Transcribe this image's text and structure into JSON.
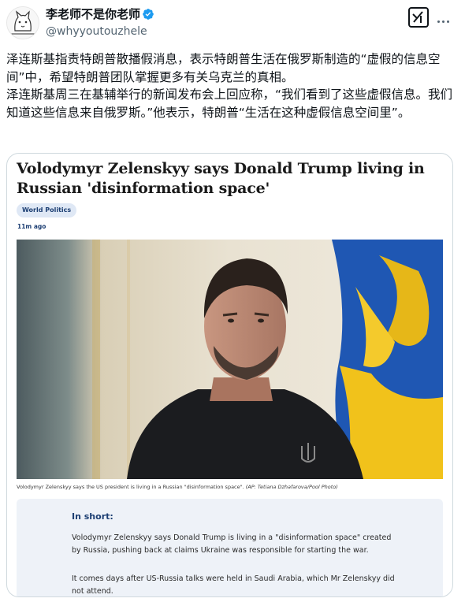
{
  "author": {
    "display_name": "李老师不是你老师",
    "handle": "@whyyoutouzhele"
  },
  "icons": {
    "verified": "verified-badge-icon",
    "grok": "grok-icon",
    "more": "more-icon"
  },
  "colors": {
    "verified": "#1d9bf0",
    "tag_bg": "#dfe8f5",
    "accent": "#1d3f73"
  },
  "tweet": {
    "paragraph_1": "泽连斯基指责特朗普散播假消息，表示特朗普生活在俄罗斯制造的“虚假的信息空间”中，希望特朗普团队掌握更多有关乌克兰的真相。",
    "paragraph_2": " 泽连斯基周三在基辅举行的新闻发布会上回应称，“我们看到了这些虚假信息。我们知道这些信息来自俄罗斯。”他表示，特朗普“生活在这种虚假信息空间里”。"
  },
  "article": {
    "headline": "Volodymyr Zelenskyy says Donald Trump living in Russian 'disinformation space'",
    "tag": "World Politics",
    "time": "11m ago",
    "caption": "Volodymyr Zelenskyy says the US president is living in a Russian \"disinformation space\".",
    "caption_credit": "(AP: Tetiana Dzhafarova/Pool Photo)",
    "short_title": "In short:",
    "short_p1": "Volodymyr Zelenskyy says Donald Trump is living in a \"disinformation space\" created by Russia, pushing back at claims Ukraine was responsible for starting the war.",
    "short_p2": "It comes days after US-Russia talks were held in Saudi Arabia, which Mr Zelenskyy did not attend."
  }
}
